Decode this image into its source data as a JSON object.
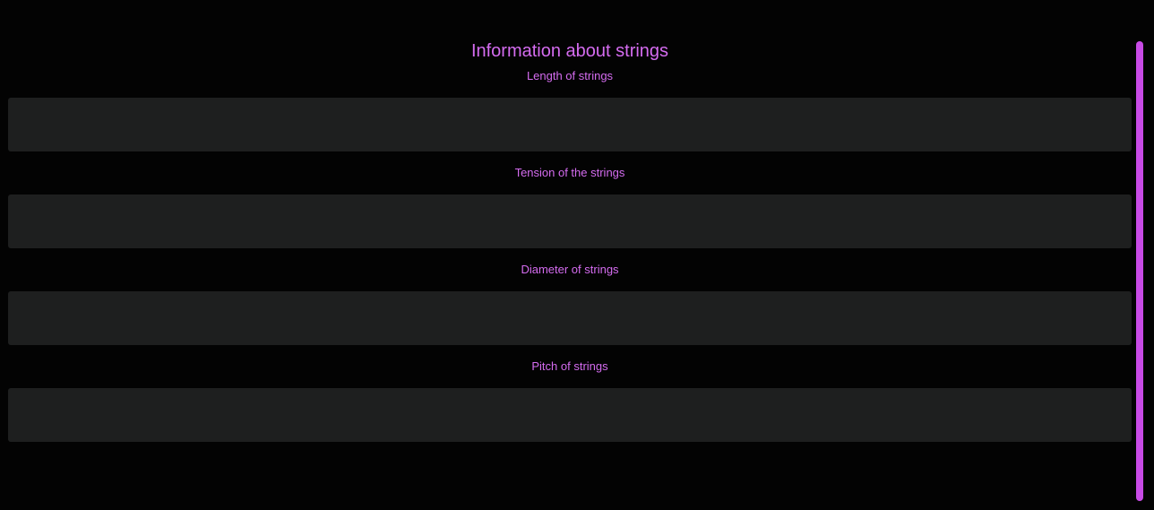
{
  "page": {
    "title": "Information about strings"
  },
  "fields": [
    {
      "label": "Length of strings",
      "value": "",
      "placeholder": ""
    },
    {
      "label": "Tension of the strings",
      "value": "",
      "placeholder": ""
    },
    {
      "label": "Diameter of strings",
      "value": "",
      "placeholder": ""
    },
    {
      "label": "Pitch of strings",
      "value": "",
      "placeholder": ""
    }
  ],
  "colors": {
    "background": "#030303",
    "accent": "#d56cf0",
    "field_background": "#1e1f1f",
    "scrollbar": "#c84be6"
  }
}
